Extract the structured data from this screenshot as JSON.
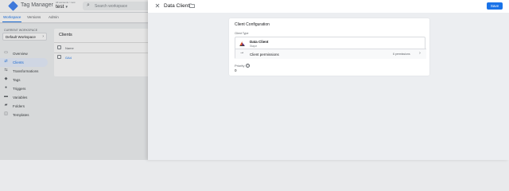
{
  "app": {
    "title": "Tag Manager",
    "account_sub": "All accounts > test",
    "container": "test",
    "search_placeholder": "Search workspace",
    "tabs": [
      {
        "label": "Workspace",
        "active": true
      },
      {
        "label": "Versions",
        "active": false
      },
      {
        "label": "Admin",
        "active": false
      }
    ],
    "workspace_label": "CURRENT WORKSPACE",
    "workspace_name": "Default Workspace",
    "nav": [
      {
        "label": "Overview",
        "icon": "overview-icon",
        "active": false
      },
      {
        "label": "Clients",
        "icon": "clients-icon",
        "active": true
      },
      {
        "label": "Transformations",
        "icon": "transformations-icon",
        "active": false
      },
      {
        "label": "Tags",
        "icon": "tag-icon",
        "active": false
      },
      {
        "label": "Triggers",
        "icon": "trigger-icon",
        "active": false
      },
      {
        "label": "Variables",
        "icon": "variables-icon",
        "active": false
      },
      {
        "label": "Folders",
        "icon": "folder-icon",
        "active": false
      },
      {
        "label": "Templates",
        "icon": "templates-icon",
        "active": false
      }
    ],
    "clients_card": {
      "title": "Clients",
      "header": "Name",
      "rows": [
        "GA4"
      ]
    }
  },
  "panel": {
    "title": "Data Client",
    "save_label": "Save",
    "card": {
      "title": "Client Configuration",
      "type_label": "Client Type",
      "type_name": "Data Client",
      "type_vendor": "Stape",
      "permissions_label": "Client permissions",
      "permissions_count": "6 permissions",
      "priority_label": "Priority",
      "priority_value": "0"
    }
  },
  "colors": {
    "accent": "#1a73e8",
    "panel_bg": "#eceef1",
    "card_bg": "#ffffff"
  }
}
